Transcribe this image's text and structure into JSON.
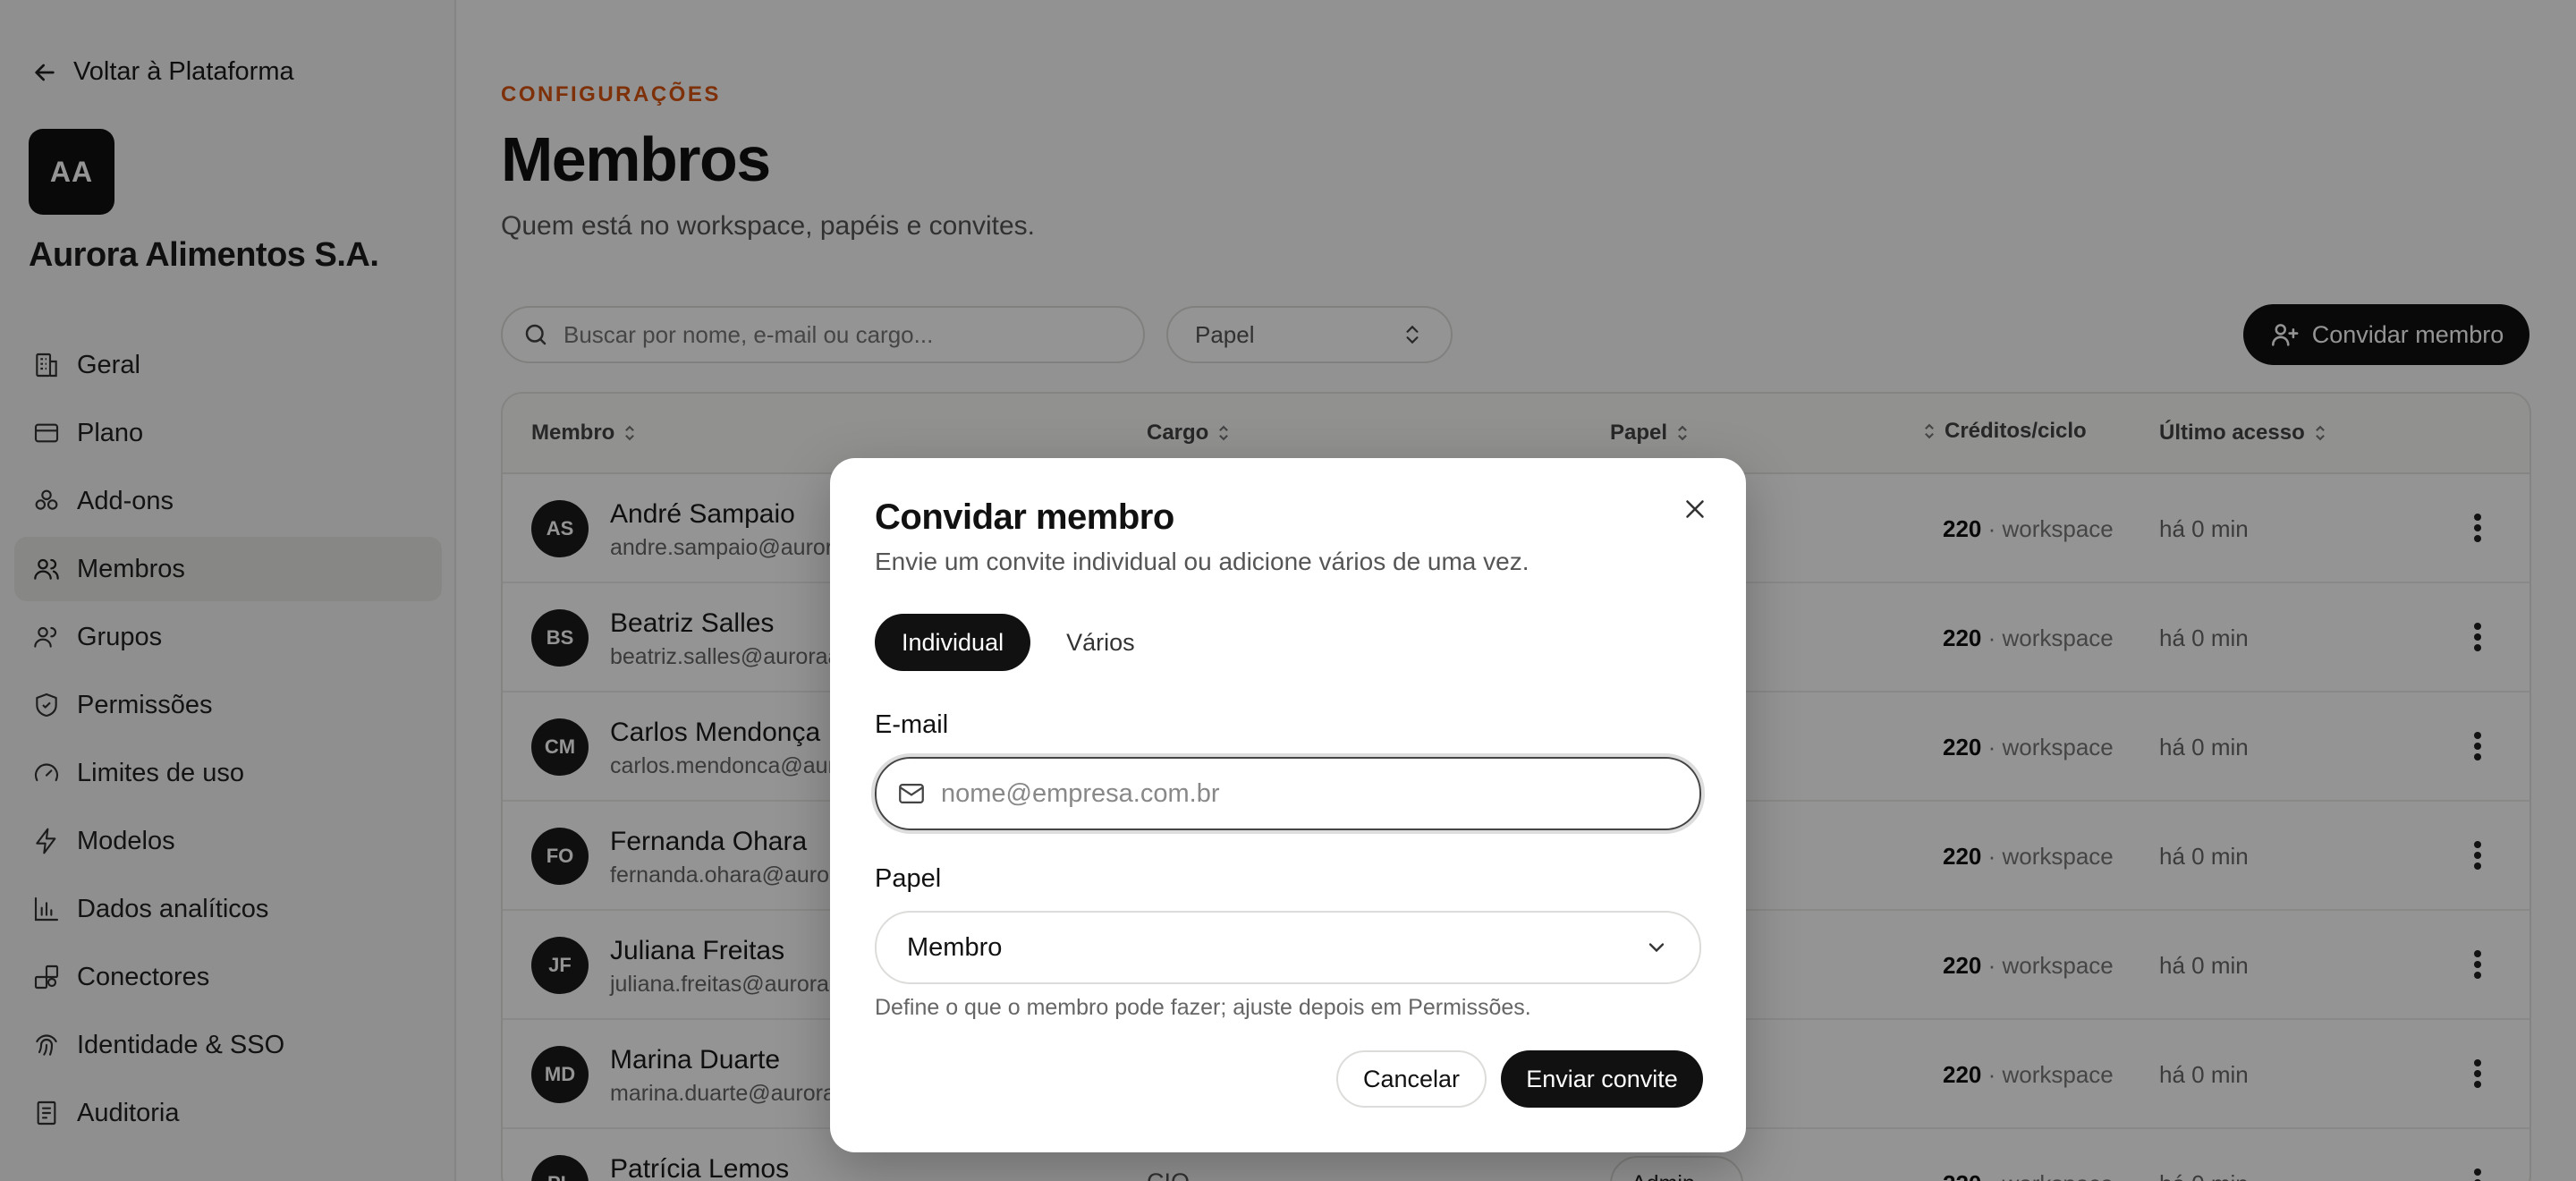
{
  "sidebar": {
    "back_label": "Voltar à Plataforma",
    "workspace_initials": "AA",
    "workspace_name": "Aurora Alimentos S.A.",
    "items": [
      {
        "label": "Geral",
        "icon": "building-icon"
      },
      {
        "label": "Plano",
        "icon": "card-icon"
      },
      {
        "label": "Add-ons",
        "icon": "puzzle-icon"
      },
      {
        "label": "Membros",
        "icon": "users-icon",
        "active": true
      },
      {
        "label": "Grupos",
        "icon": "group-icon"
      },
      {
        "label": "Permissões",
        "icon": "shield-icon"
      },
      {
        "label": "Limites de uso",
        "icon": "gauge-icon"
      },
      {
        "label": "Modelos",
        "icon": "bolt-icon"
      },
      {
        "label": "Dados analíticos",
        "icon": "bar-chart-icon"
      },
      {
        "label": "Conectores",
        "icon": "connector-icon"
      },
      {
        "label": "Identidade & SSO",
        "icon": "fingerprint-icon"
      },
      {
        "label": "Auditoria",
        "icon": "audit-icon"
      }
    ]
  },
  "header": {
    "eyebrow": "CONFIGURAÇÕES",
    "title": "Membros",
    "subtitle": "Quem está no workspace, papéis e convites."
  },
  "toolbar": {
    "search_placeholder": "Buscar por nome, e-mail ou cargo...",
    "role_filter": "Papel",
    "invite_label": "Convidar membro"
  },
  "table": {
    "columns": [
      "Membro",
      "Cargo",
      "Papel",
      "Créditos/ciclo",
      "Último acesso"
    ],
    "rows": [
      {
        "initials": "AS",
        "name": "André Sampaio",
        "email": "andre.sampaio@auroraalimentos.com.br",
        "cargo": "",
        "role": "",
        "credits": "220",
        "credits_suffix": " · workspace",
        "last_access": "há 0 min"
      },
      {
        "initials": "BS",
        "name": "Beatriz Salles",
        "email": "beatriz.salles@auroraalimentos.com.br",
        "cargo": "",
        "role": "",
        "credits": "220",
        "credits_suffix": " · workspace",
        "last_access": "há 0 min"
      },
      {
        "initials": "CM",
        "name": "Carlos Mendonça",
        "email": "carlos.mendonca@auroraalimentos.com.br",
        "cargo": "",
        "role": "",
        "credits": "220",
        "credits_suffix": " · workspace",
        "last_access": "há 0 min"
      },
      {
        "initials": "FO",
        "name": "Fernanda Ohara",
        "email": "fernanda.ohara@auroraalimentos.com.br",
        "cargo": "",
        "role": "",
        "credits": "220",
        "credits_suffix": " · workspace",
        "last_access": "há 0 min"
      },
      {
        "initials": "JF",
        "name": "Juliana Freitas",
        "email": "juliana.freitas@auroraalimentos.com.br",
        "cargo": "",
        "role": "",
        "credits": "220",
        "credits_suffix": " · workspace",
        "last_access": "há 0 min"
      },
      {
        "initials": "MD",
        "name": "Marina Duarte",
        "email": "marina.duarte@auroraalimentos.com.br",
        "cargo": "",
        "role": "",
        "credits": "220",
        "credits_suffix": " · workspace",
        "last_access": "há 0 min"
      },
      {
        "initials": "PL",
        "name": "Patrícia Lemos",
        "email": "",
        "cargo": "CIO",
        "role": "Admin",
        "credits": "220",
        "credits_suffix": " · workspace",
        "last_access": "há 0 min"
      }
    ]
  },
  "modal": {
    "title": "Convidar membro",
    "description": "Envie um convite individual ou adicione vários de uma vez.",
    "tabs": [
      "Individual",
      "Vários"
    ],
    "email_label": "E-mail",
    "email_placeholder": "nome@empresa.com.br",
    "role_label": "Papel",
    "role_value": "Membro",
    "role_hint": "Define o que o membro pode fazer; ajuste depois em Permissões.",
    "cancel_label": "Cancelar",
    "submit_label": "Enviar convite"
  }
}
